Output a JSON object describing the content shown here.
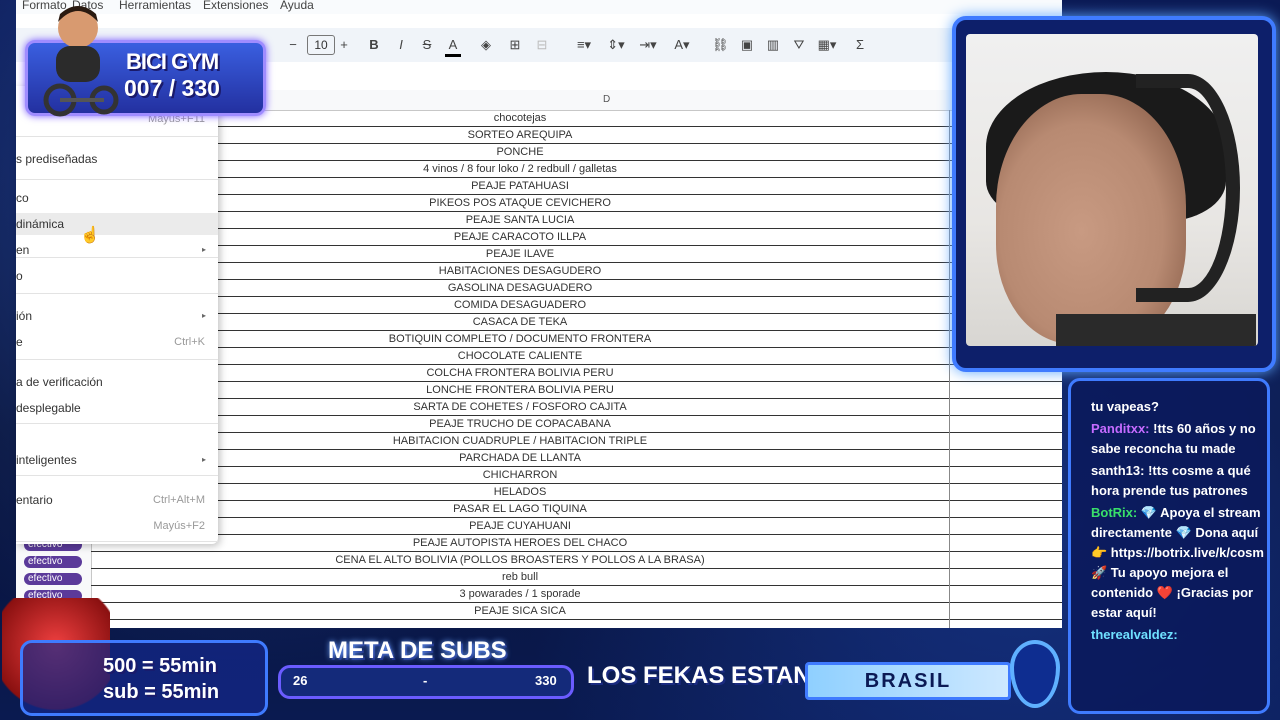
{
  "menubar": {
    "items": [
      "Formato",
      "Datos",
      "Herramientas",
      "Extensiones",
      "Ayuda"
    ]
  },
  "toolbar": {
    "font_size": "10",
    "minus": "−",
    "plus": "+",
    "bold": "B",
    "italic": "I",
    "strike": "S",
    "textcolor": "A",
    "sigma": "Σ"
  },
  "column_header": "D",
  "rows": [
    "chocotejas",
    "SORTEO AREQUIPA",
    "PONCHE",
    "4 vinos / 8 four loko / 2 redbull / galletas",
    "PEAJE PATAHUASI",
    "PIKEOS POS ATAQUE CEVICHERO",
    "PEAJE SANTA LUCIA",
    "PEAJE CARACOTO ILLPA",
    "PEAJE ILAVE",
    "HABITACIONES DESAGUDERO",
    "GASOLINA DESAGUADERO",
    "COMIDA DESAGUADERO",
    "CASACA DE TEKA",
    "BOTIQUIN COMPLETO / DOCUMENTO FRONTERA",
    "CHOCOLATE CALIENTE",
    "COLCHA FRONTERA BOLIVIA PERU",
    "LONCHE FRONTERA BOLIVIA PERU",
    "SARTA DE COHETES / FOSFORO CAJITA",
    "PEAJE TRUCHO DE COPACABANA",
    "HABITACION CUADRUPLE / HABITACION TRIPLE",
    "PARCHADA DE LLANTA",
    "CHICHARRON",
    "HELADOS",
    "PASAR EL LAGO TIQUINA",
    "PEAJE CUYAHUANI",
    "PEAJE AUTOPISTA HEROES DEL CHACO",
    "CENA EL ALTO BOLIVIA (POLLOS BROASTERS Y POLLOS A LA BRASA)",
    "reb bull",
    "3 powarades / 1 sporade",
    "PEAJE SICA SICA"
  ],
  "chips": [
    "efectivo",
    "efectivo",
    "efectivo",
    "efectivo",
    "efectivo"
  ],
  "menu": {
    "items": [
      {
        "label": "",
        "shortcut": "Mayús+F11"
      },
      {
        "label": "s prediseñadas",
        "shortcut": ""
      },
      {
        "label": "co",
        "shortcut": ""
      },
      {
        "label": " dinámica",
        "shortcut": ""
      },
      {
        "label": "en",
        "shortcut": "",
        "arrow": "▸"
      },
      {
        "label": "o",
        "shortcut": ""
      },
      {
        "label": "ión",
        "shortcut": "",
        "arrow": "▸"
      },
      {
        "label": "e",
        "shortcut": "Ctrl+K"
      },
      {
        "label": "a de verificación",
        "shortcut": ""
      },
      {
        "label": " desplegable",
        "shortcut": ""
      },
      {
        "label": " inteligentes",
        "shortcut": "",
        "arrow": "▸"
      },
      {
        "label": "entario",
        "shortcut": "Ctrl+Alt+M"
      },
      {
        "label": "",
        "shortcut": "Mayús+F2"
      }
    ]
  },
  "overlay": {
    "bici_title": "BICI GYM",
    "bici_count": "007 / 330",
    "sub_line1": "500 = 55min",
    "sub_line2": "sub = 55min",
    "meta_title": "META DE SUBS",
    "meta_start": "26",
    "meta_mid": "-",
    "meta_end": "330",
    "fekas": "LOS FEKAS ESTAN EN:",
    "location": "BRASIL"
  },
  "chat": [
    {
      "user": "",
      "text": "tu vapeas?"
    },
    {
      "user": "Panditxx:",
      "text": "!tts 60 años y no sabe reconcha tu made"
    },
    {
      "user": "santh13:",
      "text": "!tts cosme a qué hora prende tus patrones"
    },
    {
      "user": "BotRix:",
      "text": "💎 Apoya el stream directamente 💎 Dona aquí 👉 https://botrix.live/k/cosm 🚀 Tu apoyo mejora el contenido ❤️ ¡Gracias por estar aquí!"
    },
    {
      "user": "therealvaldez:",
      "text": ""
    }
  ]
}
